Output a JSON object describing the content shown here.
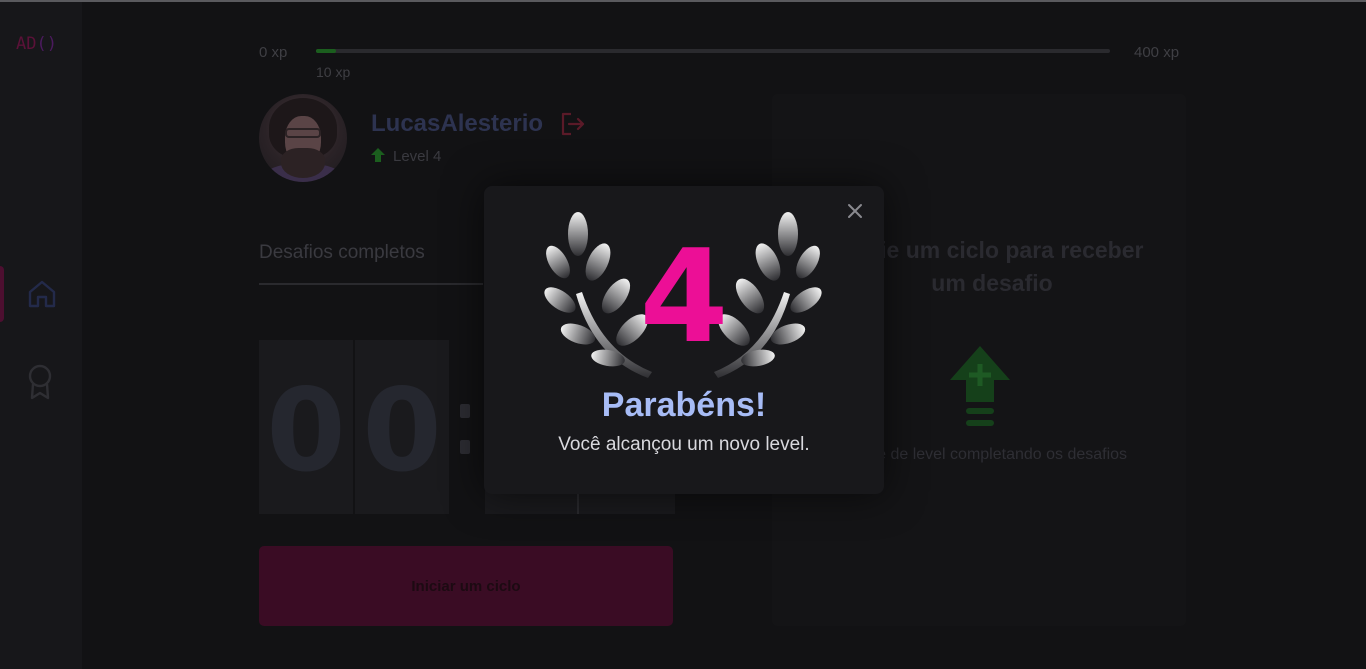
{
  "app": {
    "logo_text": "AD",
    "logo_suffix": "()"
  },
  "xp": {
    "min_label": "0 xp",
    "max_label": "400 xp",
    "current_label": "10 xp",
    "progress_fraction": 0.025
  },
  "profile": {
    "username": "LucasAlesterio",
    "level_label": "Level 4"
  },
  "challenges": {
    "completed_label": "Desafios completos"
  },
  "countdown": {
    "minutes": [
      "0",
      "0"
    ]
  },
  "start_button": {
    "label": "Iniciar um ciclo"
  },
  "challenge_box": {
    "title": "Inicie um ciclo para receber um desafio",
    "hint": "Avance de level completando os desafios"
  },
  "modal": {
    "level": "4",
    "title": "Parabéns!",
    "subtitle": "Você alcançou um novo level."
  },
  "colors": {
    "accent": "#ec0f96",
    "title_blue": "#a7bcf6",
    "green": "#4cd62b"
  }
}
